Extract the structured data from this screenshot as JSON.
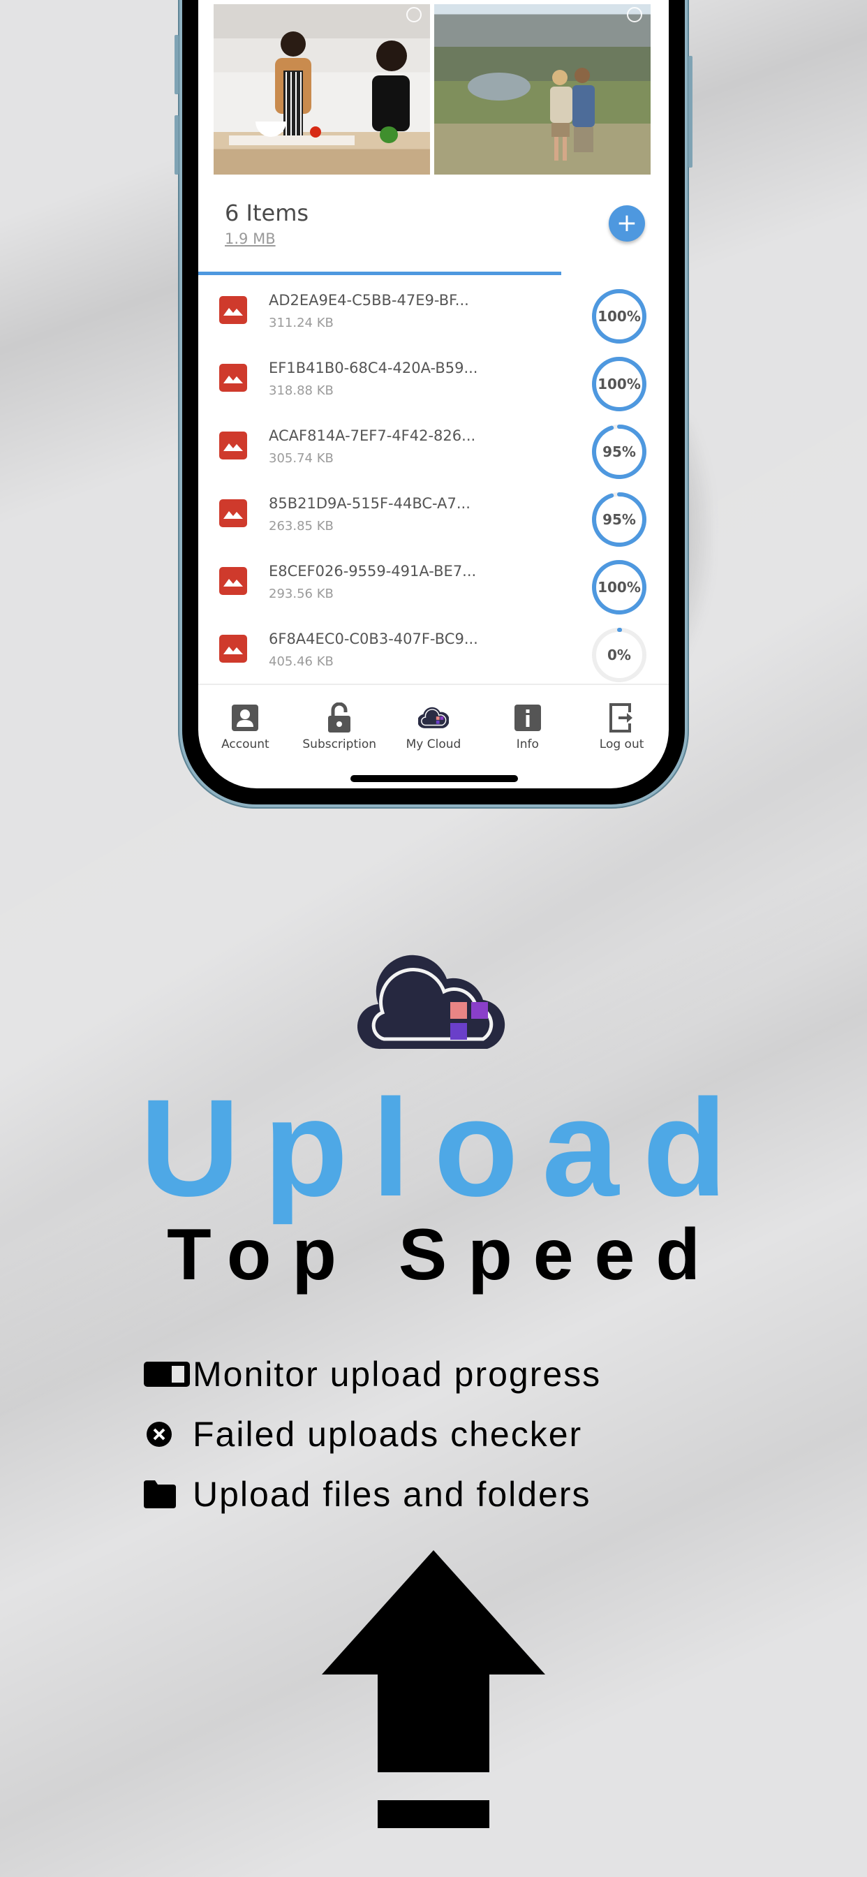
{
  "app": {
    "items_header": {
      "title": "6 Items",
      "total_size": "1.9 MB"
    },
    "add_button": {
      "icon": "plus-icon",
      "label": "+"
    },
    "photos": [
      {
        "name": "kitchen-photo",
        "selected": false
      },
      {
        "name": "mountain-photo",
        "selected": false
      }
    ],
    "files": [
      {
        "name": "AD2EA9E4-C5BB-47E9-BF...",
        "size": "311.24 KB",
        "progress": 100,
        "progress_label": "100%"
      },
      {
        "name": "EF1B41B0-68C4-420A-B59...",
        "size": "318.88 KB",
        "progress": 100,
        "progress_label": "100%"
      },
      {
        "name": "ACAF814A-7EF7-4F42-826...",
        "size": "305.74 KB",
        "progress": 95,
        "progress_label": "95%"
      },
      {
        "name": "85B21D9A-515F-44BC-A7...",
        "size": "263.85 KB",
        "progress": 95,
        "progress_label": "95%"
      },
      {
        "name": "E8CEF026-9559-491A-BE7...",
        "size": "293.56 KB",
        "progress": 100,
        "progress_label": "100%"
      },
      {
        "name": "6F8A4EC0-C0B3-407F-BC9...",
        "size": "405.46 KB",
        "progress": 0,
        "progress_label": "0%"
      }
    ],
    "tab_bar": [
      {
        "label": "Account",
        "icon": "account-icon"
      },
      {
        "label": "Subscription",
        "icon": "unlock-icon"
      },
      {
        "label": "My Cloud",
        "icon": "cloud-icon"
      },
      {
        "label": "Info",
        "icon": "info-icon"
      },
      {
        "label": "Log out",
        "icon": "logout-icon"
      }
    ]
  },
  "promo": {
    "headline": "Upload",
    "subheadline": "Top Speed",
    "features": [
      {
        "icon": "progress-toggle-icon",
        "text": "Monitor upload progress"
      },
      {
        "icon": "x-circle-icon",
        "text": "Failed uploads checker"
      },
      {
        "icon": "folder-icon",
        "text": "Upload files and folders"
      }
    ]
  },
  "colors": {
    "accent": "#4e98df",
    "headline": "#4ea8e6",
    "file_icon": "#cf3a2c",
    "ring_track": "#eeeeee",
    "logo_dark": "#262840",
    "logo_pink": "#e98585",
    "logo_purple": "#8a3fc9",
    "logo_violet": "#6a3fc9"
  }
}
